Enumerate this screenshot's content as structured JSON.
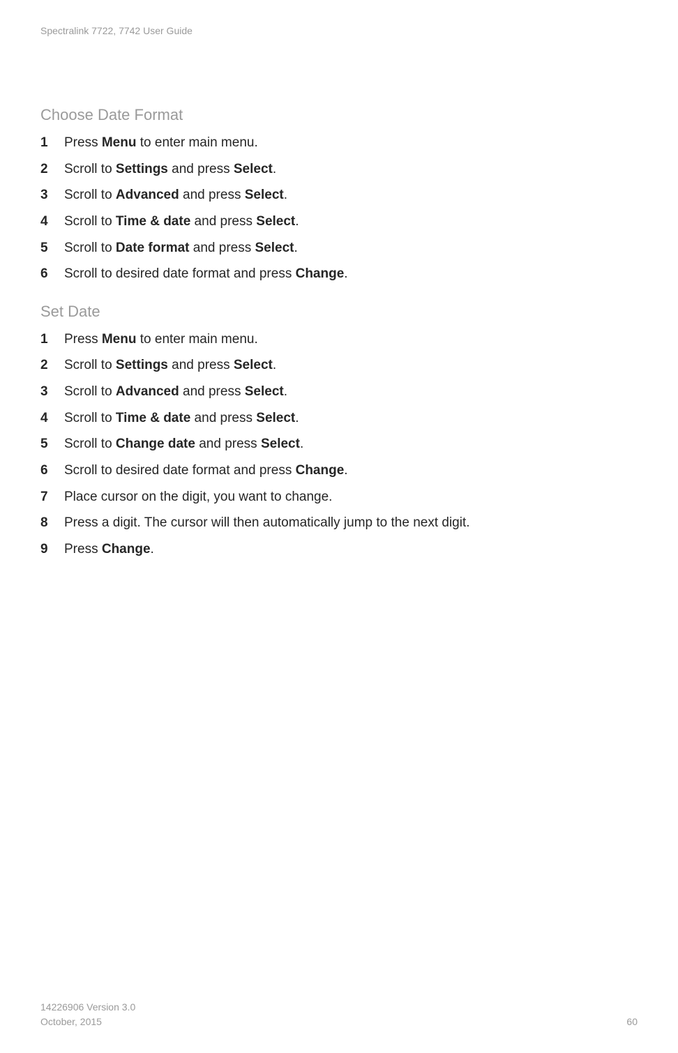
{
  "header": {
    "title": "Spectralink 7722, 7742  User Guide"
  },
  "sections": [
    {
      "heading": "Choose Date Format",
      "steps": [
        {
          "pre": "Press ",
          "b1": "Menu",
          "mid": " to enter main menu.",
          "b2": "",
          "post": ""
        },
        {
          "pre": "Scroll to ",
          "b1": "Settings",
          "mid": " and press ",
          "b2": "Select",
          "post": "."
        },
        {
          "pre": "Scroll to ",
          "b1": "Advanced",
          "mid": " and press ",
          "b2": "Select",
          "post": "."
        },
        {
          "pre": "Scroll to ",
          "b1": "Time & date",
          "mid": " and press ",
          "b2": "Select",
          "post": "."
        },
        {
          "pre": "Scroll to ",
          "b1": "Date format",
          "mid": " and press ",
          "b2": "Select",
          "post": "."
        },
        {
          "pre": "Scroll to desired date format and press ",
          "b1": "Change",
          "mid": ".",
          "b2": "",
          "post": ""
        }
      ]
    },
    {
      "heading": "Set Date",
      "steps": [
        {
          "pre": "Press ",
          "b1": "Menu",
          "mid": " to enter main menu.",
          "b2": "",
          "post": ""
        },
        {
          "pre": "Scroll to ",
          "b1": "Settings",
          "mid": " and press ",
          "b2": "Select",
          "post": "."
        },
        {
          "pre": "Scroll to ",
          "b1": "Advanced",
          "mid": " and press ",
          "b2": "Select",
          "post": "."
        },
        {
          "pre": "Scroll to ",
          "b1": "Time & date",
          "mid": " and press ",
          "b2": "Select",
          "post": "."
        },
        {
          "pre": "Scroll to ",
          "b1": "Change date",
          "mid": " and press ",
          "b2": "Select",
          "post": "."
        },
        {
          "pre": "Scroll to desired date format and press ",
          "b1": "Change",
          "mid": ".",
          "b2": "",
          "post": ""
        },
        {
          "pre": "Place cursor on the digit, you want to change.",
          "b1": "",
          "mid": "",
          "b2": "",
          "post": ""
        },
        {
          "pre": "Press a digit. The cursor will then automatically jump to the next digit.",
          "b1": "",
          "mid": "",
          "b2": "",
          "post": ""
        },
        {
          "pre": "Press ",
          "b1": "Change",
          "mid": ".",
          "b2": "",
          "post": ""
        }
      ]
    }
  ],
  "footer": {
    "line1": "14226906 Version 3.0",
    "line2": "October, 2015",
    "page": "60"
  }
}
